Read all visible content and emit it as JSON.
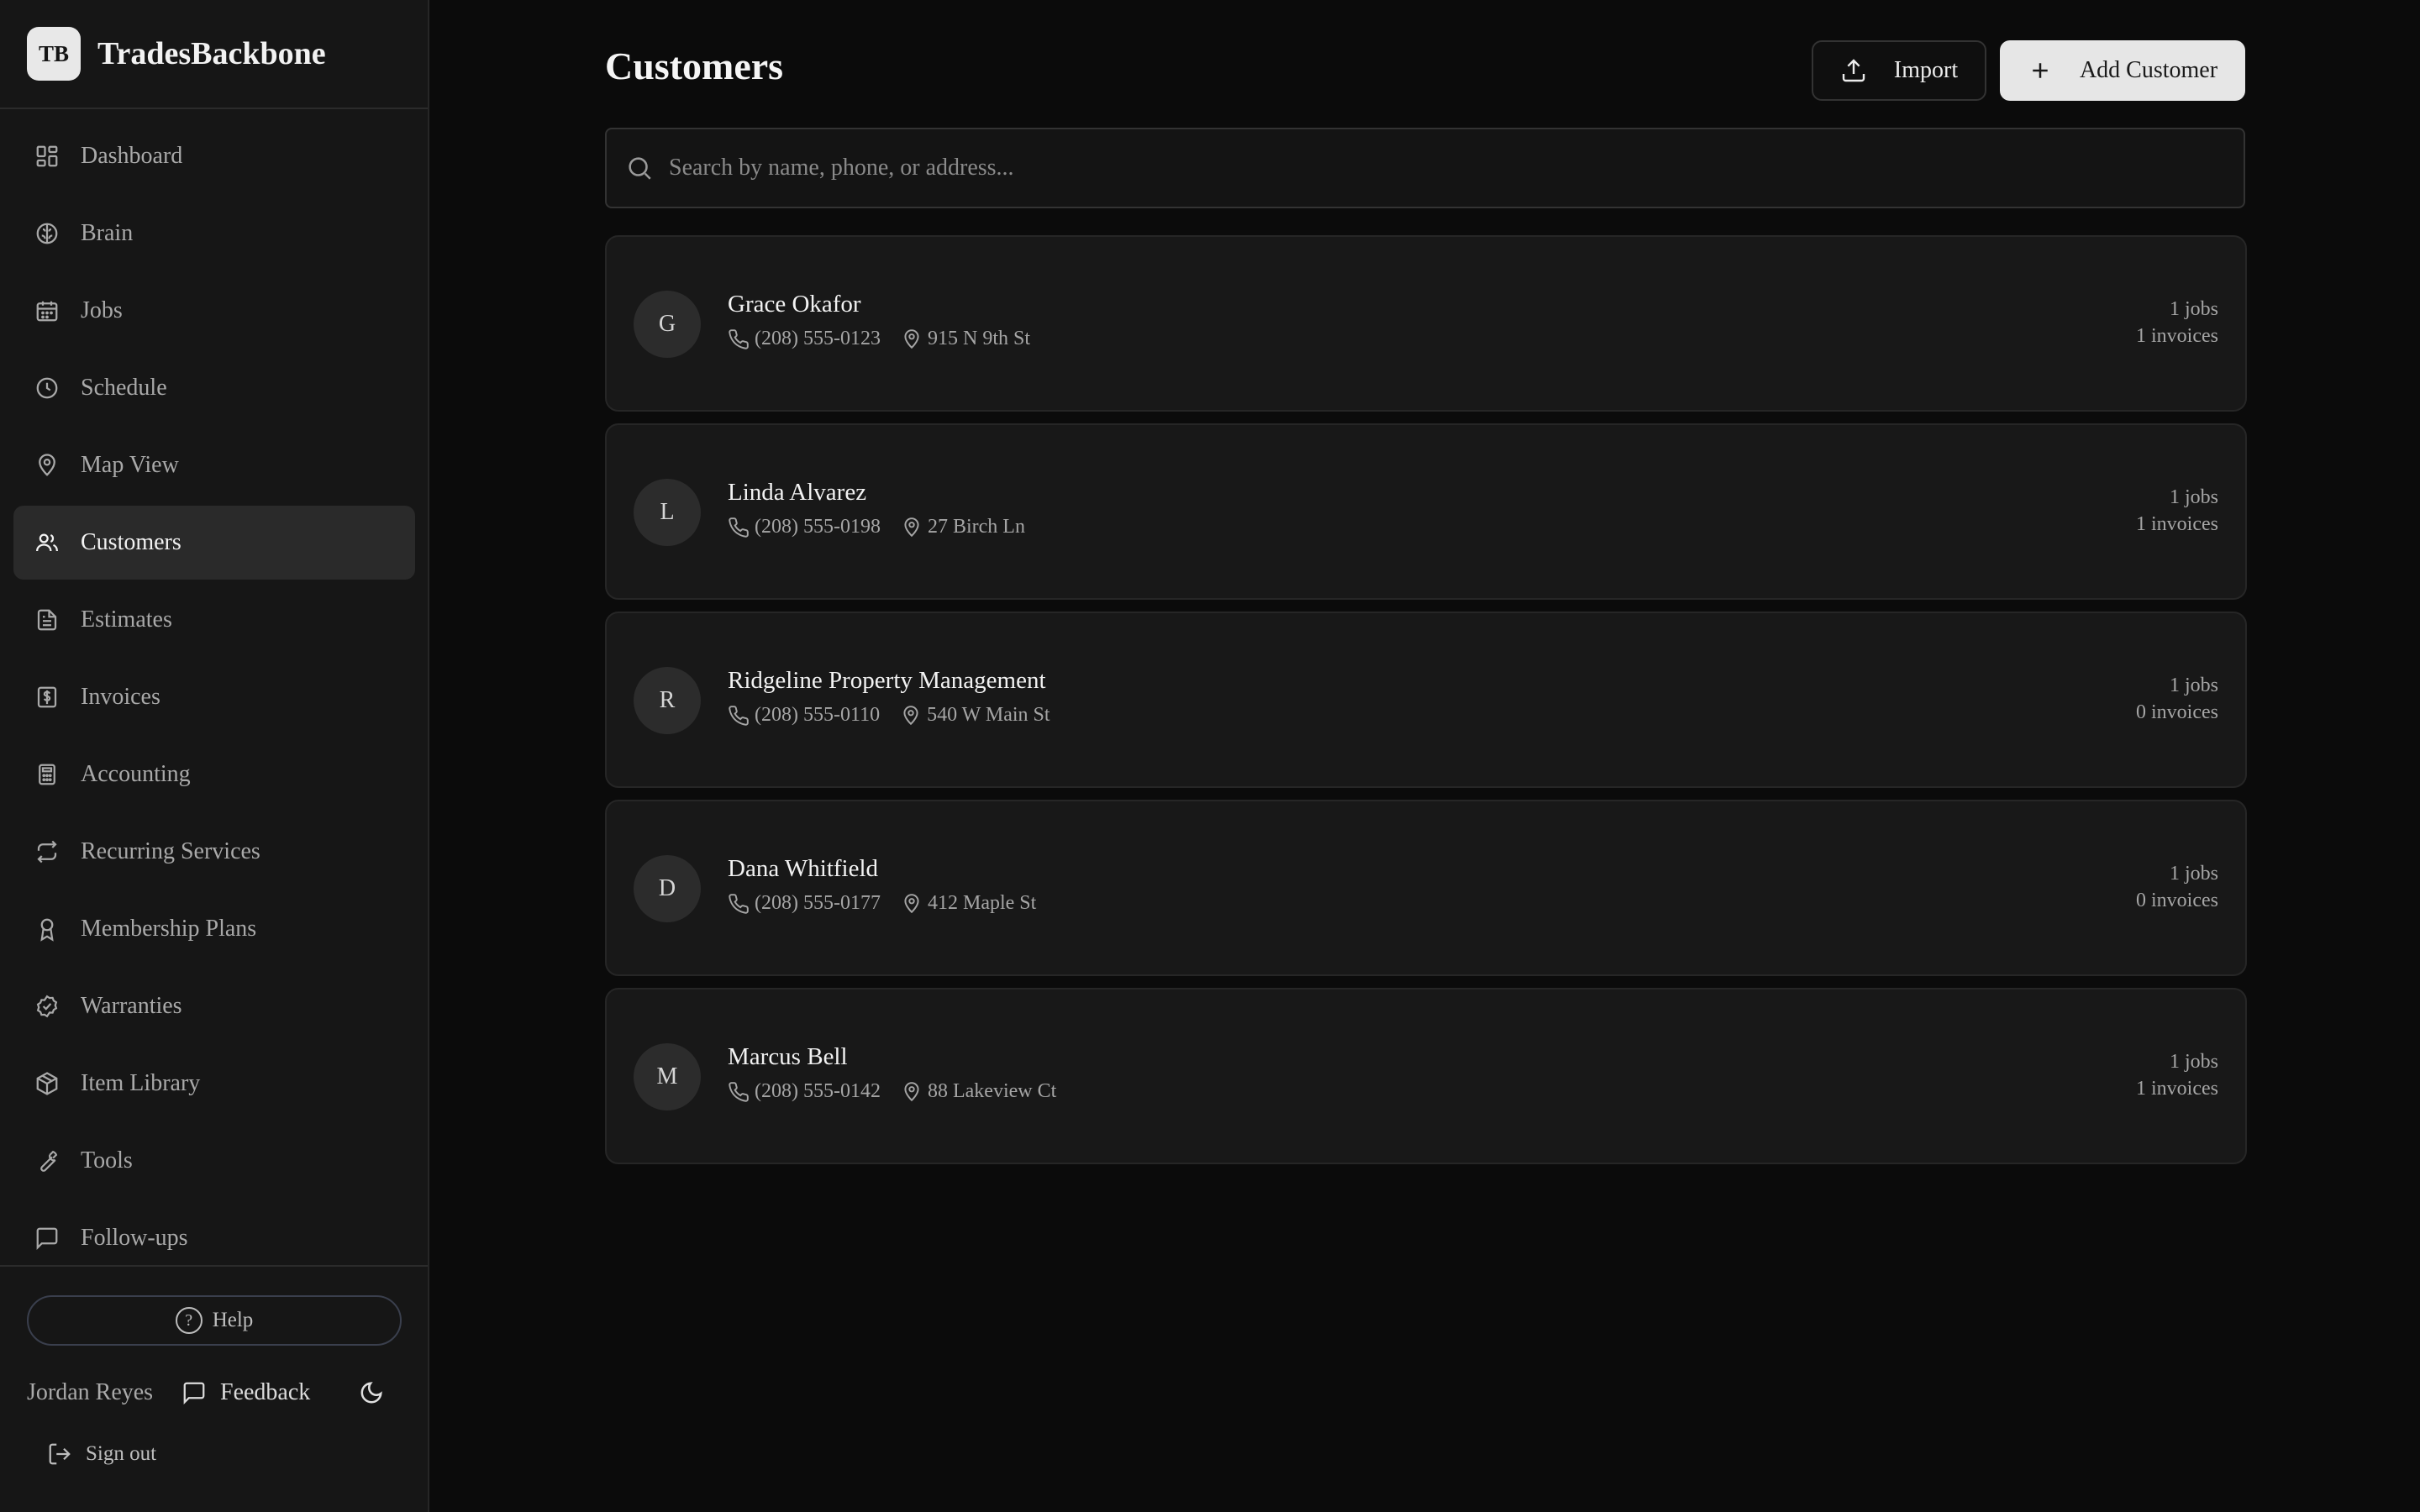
{
  "brand": {
    "logo": "TB",
    "name": "TradesBackbone"
  },
  "nav": [
    {
      "label": "Dashboard",
      "icon": "dashboard-icon",
      "active": false
    },
    {
      "label": "Brain",
      "icon": "brain-icon",
      "active": false
    },
    {
      "label": "Jobs",
      "icon": "calendar-icon",
      "active": false
    },
    {
      "label": "Schedule",
      "icon": "clock-icon",
      "active": false
    },
    {
      "label": "Map View",
      "icon": "map-pin-icon",
      "active": false
    },
    {
      "label": "Customers",
      "icon": "users-icon",
      "active": true
    },
    {
      "label": "Estimates",
      "icon": "document-icon",
      "active": false
    },
    {
      "label": "Invoices",
      "icon": "invoice-dollar-icon",
      "active": false
    },
    {
      "label": "Accounting",
      "icon": "calculator-icon",
      "active": false
    },
    {
      "label": "Recurring Services",
      "icon": "repeat-icon",
      "active": false
    },
    {
      "label": "Membership Plans",
      "icon": "award-icon",
      "active": false
    },
    {
      "label": "Warranties",
      "icon": "badge-check-icon",
      "active": false
    },
    {
      "label": "Item Library",
      "icon": "package-icon",
      "active": false
    },
    {
      "label": "Tools",
      "icon": "wrench-icon",
      "active": false
    },
    {
      "label": "Follow-ups",
      "icon": "message-square-icon",
      "active": false
    }
  ],
  "footer": {
    "help_label": "Help",
    "help_glyph": "?",
    "user_name": "Jordan Reyes",
    "feedback_label": "Feedback",
    "signout_label": "Sign out"
  },
  "header": {
    "title": "Customers",
    "import_label": "Import",
    "add_label": "Add Customer"
  },
  "search": {
    "placeholder": "Search by name, phone, or address..."
  },
  "customers": [
    {
      "initial": "G",
      "name": "Grace Okafor",
      "phone": "(208) 555-0123",
      "address": "915 N 9th St",
      "jobs": "1 jobs",
      "invoices": "1 invoices"
    },
    {
      "initial": "L",
      "name": "Linda Alvarez",
      "phone": "(208) 555-0198",
      "address": "27 Birch Ln",
      "jobs": "1 jobs",
      "invoices": "1 invoices"
    },
    {
      "initial": "R",
      "name": "Ridgeline Property Management",
      "phone": "(208) 555-0110",
      "address": "540 W Main St",
      "jobs": "1 jobs",
      "invoices": "0 invoices"
    },
    {
      "initial": "D",
      "name": "Dana Whitfield",
      "phone": "(208) 555-0177",
      "address": "412 Maple St",
      "jobs": "1 jobs",
      "invoices": "0 invoices"
    },
    {
      "initial": "M",
      "name": "Marcus Bell",
      "phone": "(208) 555-0142",
      "address": "88 Lakeview Ct",
      "jobs": "1 jobs",
      "invoices": "1 invoices"
    }
  ],
  "colors": {
    "background": "#0b0b0b",
    "sidebar": "#161616",
    "card": "#181818",
    "active_nav": "#2a2a2a",
    "primary_button": "#e6e6e6"
  }
}
